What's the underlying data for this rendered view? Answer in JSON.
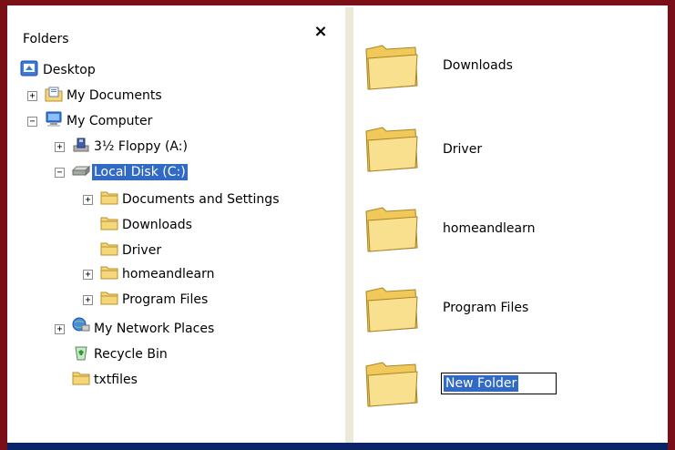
{
  "folders_pane": {
    "title": "Folders",
    "close_glyph": "×"
  },
  "tree": {
    "desktop": "Desktop",
    "my_documents": "My Documents",
    "my_computer": "My Computer",
    "floppy": "3½ Floppy (A:)",
    "local_disk": "Local Disk (C:)",
    "docs_settings": "Documents and Settings",
    "downloads": "Downloads",
    "driver": "Driver",
    "homeandlearn": "homeandlearn",
    "program_files": "Program Files",
    "network": "My Network Places",
    "recycle": "Recycle Bin",
    "txtfiles": "txtfiles",
    "plus": "+",
    "minus": "−"
  },
  "content": {
    "items": [
      "Downloads",
      "Driver",
      "homeandlearn",
      "Program Files"
    ],
    "rename_value": "New Folder"
  },
  "colors": {
    "frame": "#7a0f18",
    "selection": "#316ac5",
    "folder": "#f5d77a"
  }
}
